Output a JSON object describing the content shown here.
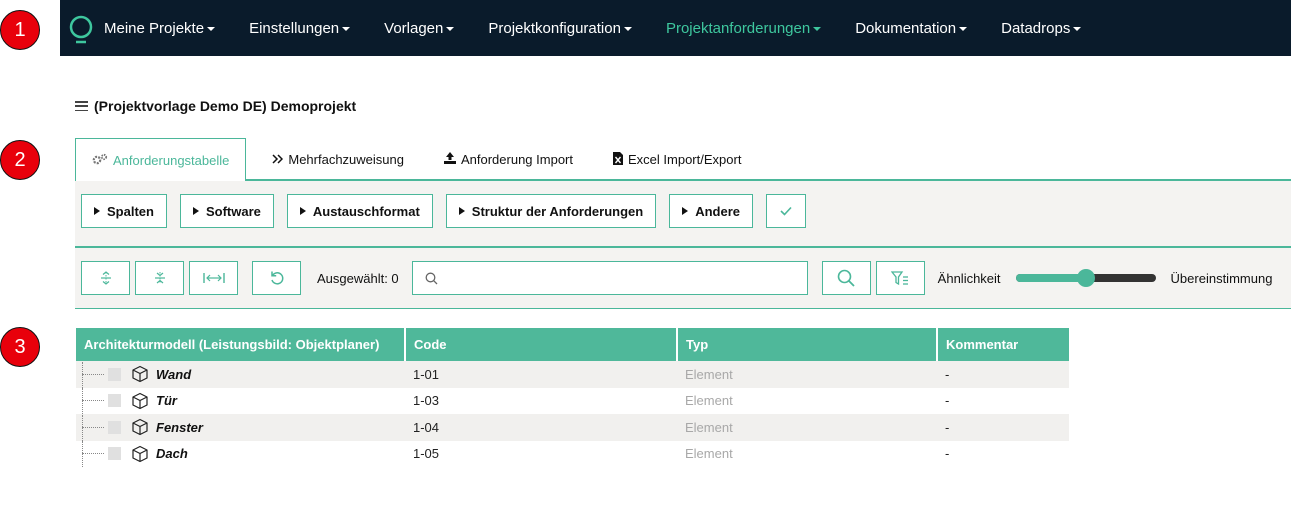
{
  "callouts": [
    "1",
    "2",
    "3"
  ],
  "nav": {
    "items": [
      {
        "label": "Meine Projekte",
        "active": false
      },
      {
        "label": "Einstellungen",
        "active": false
      },
      {
        "label": "Vorlagen",
        "active": false
      },
      {
        "label": "Projektkonfiguration",
        "active": false
      },
      {
        "label": "Projektanforderungen",
        "active": true
      },
      {
        "label": "Dokumentation",
        "active": false
      },
      {
        "label": "Datadrops",
        "active": false
      }
    ]
  },
  "project": {
    "title": "(Projektvorlage Demo DE) Demoprojekt"
  },
  "tabs": [
    {
      "label": "Anforderungstabelle",
      "icon": "gears-icon",
      "active": true
    },
    {
      "label": "Mehrfachzuweisung",
      "icon": "double-chevron-right-icon",
      "active": false
    },
    {
      "label": "Anforderung Import",
      "icon": "upload-icon",
      "active": false
    },
    {
      "label": "Excel Import/Export",
      "icon": "excel-file-icon",
      "active": false
    }
  ],
  "toolbar": {
    "buttons": [
      "Spalten",
      "Software",
      "Austauschformat",
      "Struktur der Anforderungen",
      "Andere"
    ],
    "selected_label": "Ausgewählt: 0",
    "search_value": "",
    "slider_left_label": "Ähnlichkeit",
    "slider_right_label": "Übereinstimmung",
    "slider_value": 0.5
  },
  "table": {
    "columns": [
      "Architekturmodell (Leistungsbild: Objektplaner)",
      "Code",
      "Typ",
      "Kommentar"
    ],
    "rows": [
      {
        "name": "Wand",
        "code": "1-01",
        "type": "Element",
        "comment": "-"
      },
      {
        "name": "Tür",
        "code": "1-03",
        "type": "Element",
        "comment": "-"
      },
      {
        "name": "Fenster",
        "code": "1-04",
        "type": "Element",
        "comment": "-"
      },
      {
        "name": "Dach",
        "code": "1-05",
        "type": "Element",
        "comment": "-"
      }
    ]
  },
  "colors": {
    "accent": "#4bb79a",
    "nav_bg": "#0a1b2b",
    "callout": "#e8000b"
  }
}
